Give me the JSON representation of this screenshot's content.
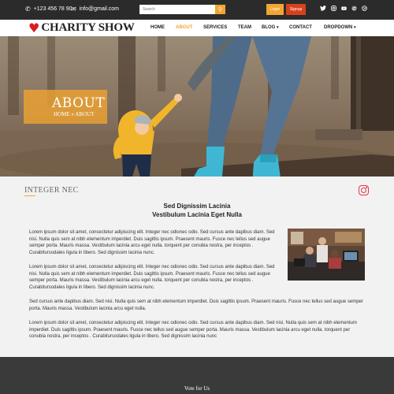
{
  "topbar": {
    "phone": "+123 456 78 90",
    "email": "info@gmail.com",
    "search_placeholder": "Search",
    "login_label": "Login",
    "signup_label": "Signup",
    "social_icons": [
      "twitter-icon",
      "instagram-icon",
      "youtube-icon",
      "google-icon",
      "globe-icon"
    ]
  },
  "brand": {
    "name": "CHARITY SHOW",
    "heart_color": "#d81f1f"
  },
  "nav": {
    "items": [
      "HOME",
      "ABOUT",
      "SERVICES",
      "TEAM",
      "BLOG",
      "CONTACT",
      "DROPDOWN"
    ],
    "active": "ABOUT"
  },
  "hero": {
    "title": "ABOUT",
    "breadcrumb_home": "HOME",
    "breadcrumb_sep": "»",
    "breadcrumb_current": "ABOUT"
  },
  "section": {
    "heading": "INTEGER NEC",
    "subtitle_line1": "Sed Dignissim Lacinia",
    "subtitle_line2": "Vestibulum Lacinia Eget Nulla",
    "paragraphs": [
      "Lorem ipsum dolor sit amet, consectetur adipiscing elit. Integer nec odionec odio. Sed cursus ante dapibus diam. Sed nisi. Nulla quis sem at nibh elementum imperdiet. Duis sagittis ipsum. Praesent mauris. Fusce nec tellus sed augue semper porta. Mauris massa. Vestibulum lacinia arcu eget nulla. torquent per conubia nostra, per inceptos . Curabitursodales ligula in libero. Sed dignissim lacinia nunc.",
      "Lorem ipsum dolor sit amet, consectetur adipiscing elit. Integer nec odionec odio. Sed cursus ante dapibus diam. Sed nisi. Nulla quis sem at nibh elementum imperdiet. Duis sagittis ipsum. Praesent mauris. Fusce nec tellus sed augue semper porta. Mauris massa. Vestibulum lacinia arcu eget nulla. torquent per conubia nostra, per inceptos . Curabitursodales ligula in libero. Sed dignissim lacinia nunc.",
      "Sed cursus ante dapibus diam. Sed nisi. Nulla quis sem at nibh elementum imperdiet. Duis sagittis ipsum. Praesent mauris. Fusce nec tellus sed augue semper porta. Mauris massa. Vestibulum lacinia arcu eget nulla.",
      "Lorem ipsum dolor sit amet, consectetur adipiscing elit. Integer nec odionec odio. Sed cursus ante dapibus diam. Sed nisi. Nulla quis sem at nibh elementum imperdiet. Duis sagittis ipsum. Praesent mauris. Fusce nec tellus sed augue semper porta. Mauris massa. Vestibulum lacinia arcu eget nulla. torquent per conubia nostra, per inceptos . Curabitursodales ligula in libero. Sed dignissim lacinia nunc"
    ]
  },
  "footer": {
    "title": "Vote for Us"
  },
  "colors": {
    "accent": "#f2a530",
    "signup": "#d6421c",
    "topbar": "#2b2b2b",
    "footer": "#3a3a3a",
    "instagram": "#e8324b"
  }
}
